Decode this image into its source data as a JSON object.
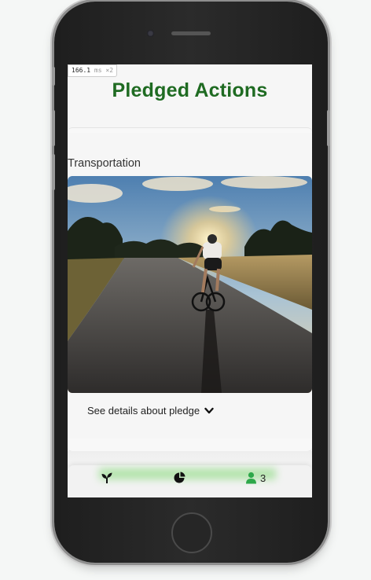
{
  "perf": {
    "value": "166.1",
    "unit": "ms",
    "multiplier": "×2"
  },
  "page": {
    "title": "Pledged Actions"
  },
  "pledge": {
    "category": "Transportation",
    "image_icon": "cyclist-road-sunset-photo",
    "details_label": "See details about pledge",
    "details_icon": "chevron-down-icon"
  },
  "nav": {
    "items": [
      {
        "icon": "sprout-icon"
      },
      {
        "icon": "pie-chart-icon"
      },
      {
        "icon": "user-icon",
        "count": "3"
      }
    ]
  },
  "colors": {
    "title_green": "#1f6b22",
    "user_icon_green": "#2ea84a",
    "screen_bg": "#f6f6f6"
  }
}
